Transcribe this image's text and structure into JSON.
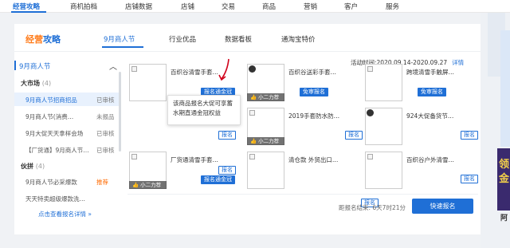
{
  "topnav": {
    "items": [
      "经营攻略",
      "商机拍档",
      "店铺数据",
      "店铺",
      "交易",
      "商品",
      "营销",
      "客户",
      "服务"
    ]
  },
  "panel": {
    "logo_a": "经营",
    "logo_b": "攻略",
    "tabs": [
      "9月商人节",
      "行业优品",
      "数据看板",
      "通淘宝特价"
    ]
  },
  "sidebar": {
    "header": "9月商人节",
    "groups": [
      {
        "label": "大市场",
        "count": "(4)"
      },
      {
        "label": "伙拼",
        "count": "(4)"
      }
    ],
    "items": [
      {
        "name": "9月商人节招商招品",
        "status": "已审核"
      },
      {
        "name": "9月商人节(消费…",
        "status": "未报品"
      },
      {
        "name": "9月大促天天拿样会场",
        "status": "已审核"
      },
      {
        "name": "【厂货通】9月商人节…",
        "status": "已审核"
      },
      {
        "name": "9月商人节必采爆款",
        "status": "推荐"
      },
      {
        "name": "天天特卖超级爆款洗…",
        "status": ""
      }
    ],
    "link": "点击查看报名详情 »"
  },
  "activity": {
    "date_range": "活动时间:2020.09.14-2020.09.27",
    "detail": "详情"
  },
  "cards": [
    {
      "title": "百织谷清雪手套…",
      "tag": "",
      "buttons": [
        "报名通金冠"
      ]
    },
    {
      "title": "百织谷送彩手套…",
      "tag": "小二力荐",
      "buttons": [
        "免审报名"
      ]
    },
    {
      "title": "跨境清雪手触屏…",
      "tag": "",
      "buttons": [
        "免审报名"
      ]
    },
    {
      "title": "",
      "tag": "",
      "buttons": [
        "报名"
      ]
    },
    {
      "title": "2019手套防水防…",
      "tag": "小二力荐",
      "buttons": [
        "报名"
      ]
    },
    {
      "title": "924大促备货节…",
      "tag": "",
      "buttons": [
        "报名"
      ]
    },
    {
      "title": "厂货通清雪手套…",
      "tag": "小二力荐",
      "buttons": [
        "报名",
        "报名通金冠"
      ]
    },
    {
      "title": "清仓款 外贸出口…",
      "tag": "",
      "buttons": [
        "报名"
      ]
    },
    {
      "title": "百织谷户外清雪…",
      "tag": "",
      "buttons": [
        "报名"
      ]
    }
  ],
  "tooltip": "该商品报名大促可享蓄水期直通金冠权益",
  "footer": {
    "countdown": "距报名结束: 6天7时21分",
    "quick_button": "快速报名"
  },
  "right_promo": {
    "text": "领金",
    "letter": "阿"
  },
  "colors": {
    "accent": "#1f6fd6",
    "orange": "#ff7a18",
    "highlight": "#ff6a00",
    "arrow": "#d0021b"
  }
}
